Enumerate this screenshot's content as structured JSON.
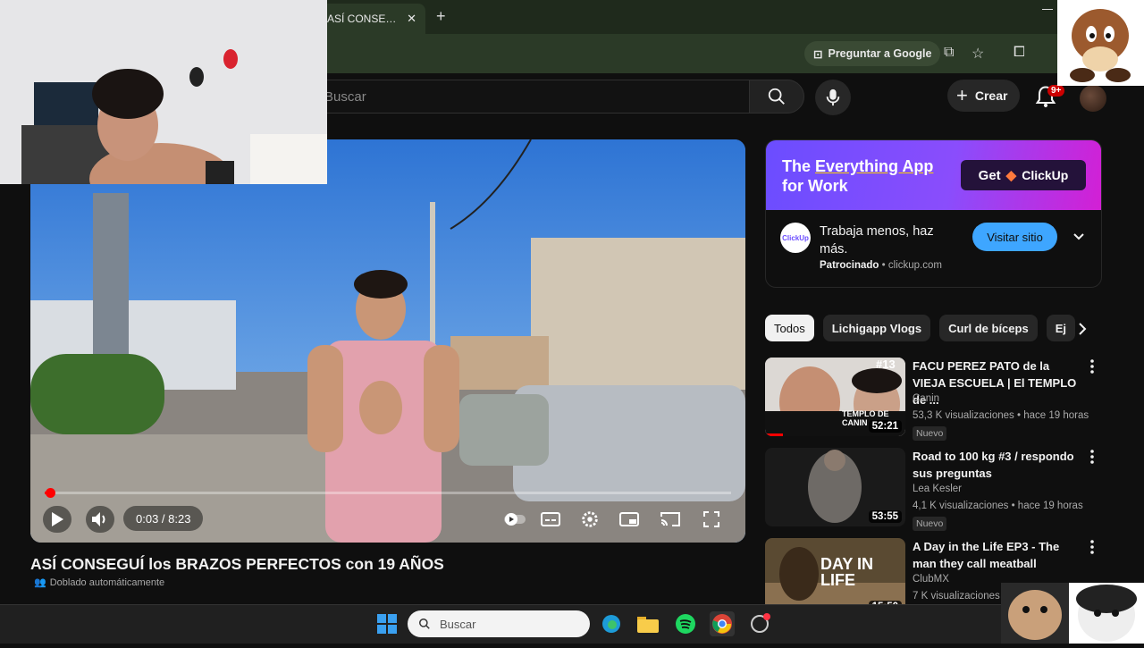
{
  "browser": {
    "tab_title": "ASÍ CONSEGUÍ los BRAZOS",
    "tab_close": "✕",
    "new_tab": "+",
    "ask_google": "Preguntar a Google"
  },
  "youtube": {
    "search_placeholder": "Buscar",
    "create_label": "Crear",
    "notification_count": "9+"
  },
  "player": {
    "time": "0:03 / 8:23",
    "progress_fraction": 0.006,
    "title": "ASÍ CONSEGUÍ los BRAZOS PERFECTOS con 19 AÑOS",
    "dubbed_label": "Doblado automáticamente"
  },
  "ad": {
    "headline_part1": "The ",
    "headline_highlight": "Everything App",
    "headline_part2": "for Work",
    "get_label": "Get",
    "brand": "ClickUp",
    "logo_text": "ClickUp",
    "text": "Trabaja menos, haz más.",
    "sponsored": "Patrocinado",
    "domain": "clickup.com",
    "visit_label": "Visitar sitio"
  },
  "chips": [
    "Todos",
    "Lichigapp Vlogs",
    "Curl de bíceps",
    "Ej"
  ],
  "recommendations": [
    {
      "title": "FACU PEREZ PATO de la VIEJA ESCUELA | El TEMPLO de ...",
      "channel": "Canin",
      "meta": "53,3 K visualizaciones • hace 19 horas",
      "badge": "Nuevo",
      "duration": "52:21",
      "thumb_text": "TEMPLO DE CANIN",
      "thumb_tag": "#13"
    },
    {
      "title": "Road to 100 kg #3 / respondo sus preguntas",
      "channel": "Lea Kesler",
      "meta": "4,1 K visualizaciones • hace 19 horas",
      "badge": "Nuevo",
      "duration": "53:55"
    },
    {
      "title": "A Day in the Life EP3 - The man they call meatball",
      "channel": "ClubMX",
      "meta": "7 K visualizaciones",
      "duration": "15:50",
      "thumb_text": "DAY IN LIFE"
    }
  ],
  "taskbar": {
    "search_label": "Buscar"
  },
  "colors": {
    "youtube_red": "#ff0000",
    "visit_button": "#3ea6ff",
    "ad_gradient_start": "#6b4dff",
    "ad_gradient_end": "#d41fd4"
  }
}
